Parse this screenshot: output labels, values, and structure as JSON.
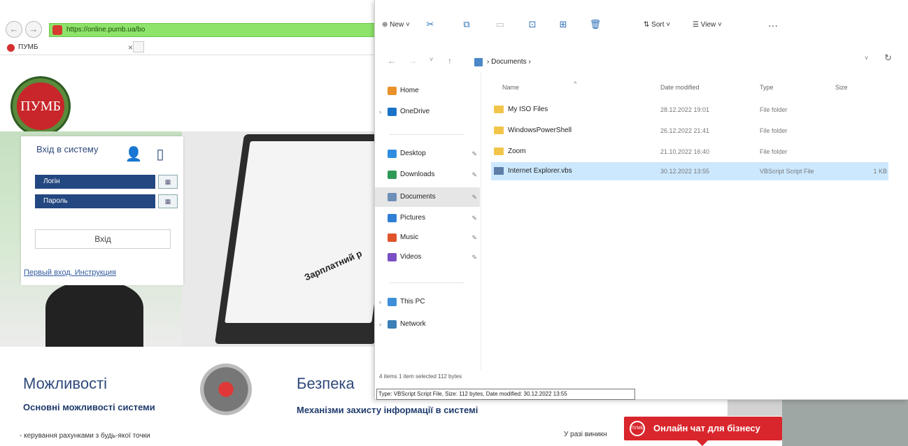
{
  "browser": {
    "address": "https://online.pumb.ua/bo",
    "tab_title": "ПУМБ",
    "tab_close": "×",
    "back_glyph": "←",
    "fwd_glyph": "→",
    "logo_text": "ПУМБ",
    "login": {
      "title": "Вхід в систему",
      "login_placeholder": "Логін",
      "password_placeholder": "Пароль",
      "submit": "Вхід",
      "help_link": "Первый вход. Инструкция"
    },
    "hero_text": "Зарплатний р",
    "features": {
      "title": "Можливості",
      "subtitle": "Основні можливості системи",
      "item": "- керування рахунками з будь-якої точки"
    },
    "security": {
      "title": "Безпека",
      "subtitle": "Механізми захисту інформації в системі",
      "note": "У разі виникн"
    },
    "chat_button": "Онлайн чат для бізнесу",
    "chat_icon_text": "ПУМБ"
  },
  "explorer": {
    "toolbar": {
      "new_label": "New",
      "sort_label": "Sort",
      "view_label": "View",
      "more_label": "···"
    },
    "breadcrumb": "Documents",
    "nav": [
      {
        "label": "Home",
        "icon": "home-icon",
        "color": "#e9922b"
      },
      {
        "label": "OneDrive",
        "icon": "cloud-icon",
        "color": "#1a73c9"
      },
      {
        "label": "Desktop",
        "icon": "desktop-icon",
        "color": "#2e8de0"
      },
      {
        "label": "Downloads",
        "icon": "download-icon",
        "color": "#2f9a55"
      },
      {
        "label": "Documents",
        "icon": "documents-icon",
        "color": "#6d8fb8"
      },
      {
        "label": "Pictures",
        "icon": "pictures-icon",
        "color": "#2f7fd4"
      },
      {
        "label": "Music",
        "icon": "music-icon",
        "color": "#e0542b"
      },
      {
        "label": "Videos",
        "icon": "videos-icon",
        "color": "#7a4fc4"
      },
      {
        "label": "This PC",
        "icon": "pc-icon",
        "color": "#3c8fd8"
      },
      {
        "label": "Network",
        "icon": "network-icon",
        "color": "#3c7fb8"
      }
    ],
    "columns": {
      "name": "Name",
      "date": "Date modified",
      "type": "Type",
      "size": "Size"
    },
    "files": [
      {
        "name": "My ISO Files",
        "date": "28.12.2022 19:01",
        "type": "File folder",
        "size": "",
        "icon": "folder-icon"
      },
      {
        "name": "WindowsPowerShell",
        "date": "26.12.2022 21:41",
        "type": "File folder",
        "size": "",
        "icon": "folder-icon"
      },
      {
        "name": "Zoom",
        "date": "21.10.2022 16:40",
        "type": "File folder",
        "size": "",
        "icon": "folder-icon"
      },
      {
        "name": "Internet Explorer.vbs",
        "date": "30.12.2022 13:55",
        "type": "VBScript Script File",
        "size": "1 KB",
        "icon": "script-file-icon"
      }
    ],
    "status": "4 items    1 item selected  112 bytes",
    "tooltip": "Type: VBScript Script File, Size: 112 bytes, Date modified: 30.12.2022 13:55"
  }
}
